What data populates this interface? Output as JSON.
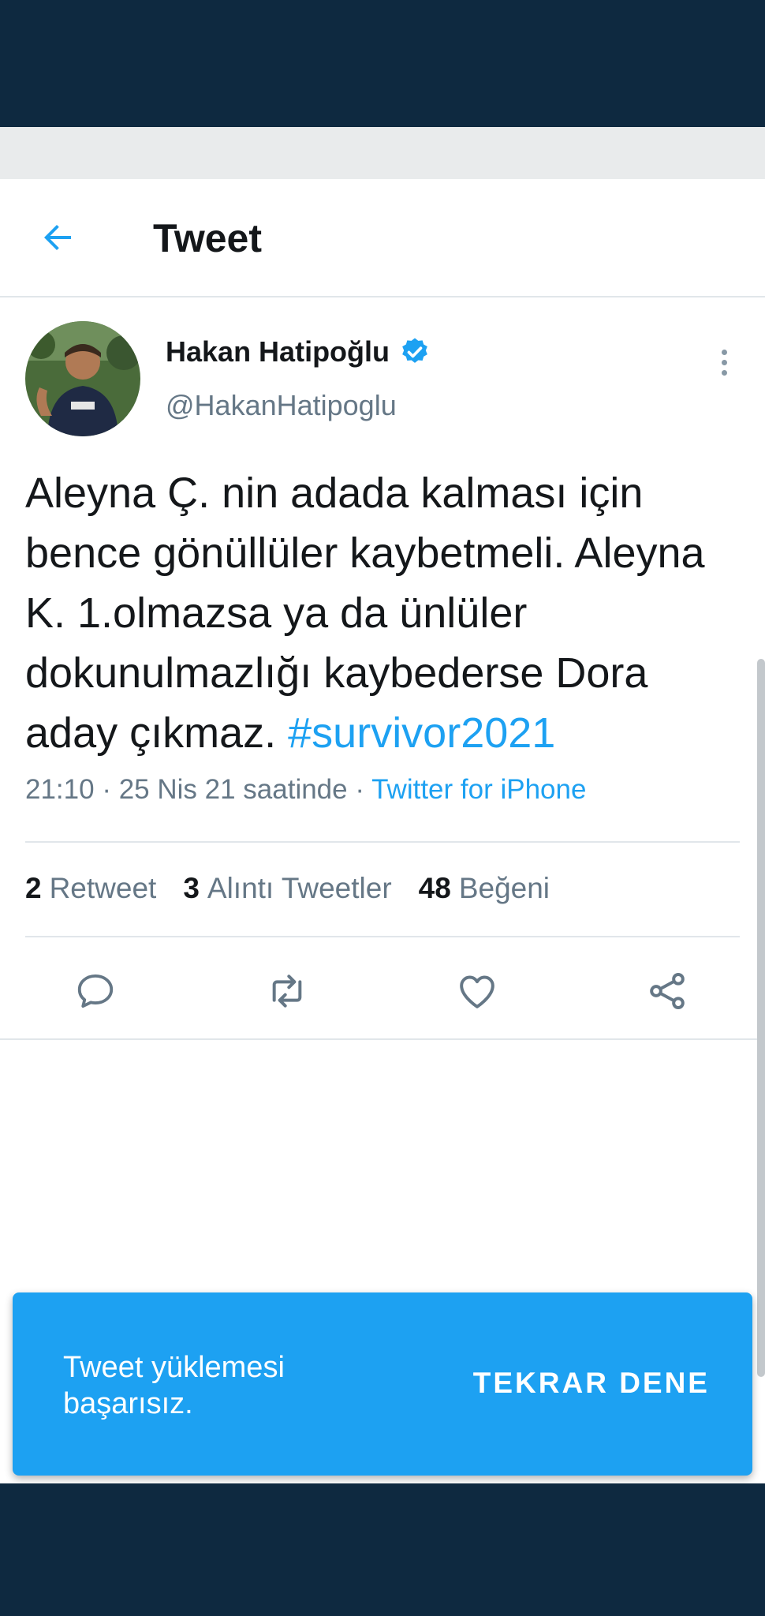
{
  "colors": {
    "accent": "#1da1f2",
    "status_bar": "#0e2940",
    "text": "#14171a",
    "secondary": "#657786"
  },
  "header": {
    "title": "Tweet",
    "back_icon": "arrow-left-icon"
  },
  "tweet": {
    "author": {
      "name": "Hakan Hatipoğlu",
      "handle": "@HakanHatipoglu",
      "verified": true
    },
    "text": "Aleyna Ç. nin adada kalması için bence gönüllüler kaybetmeli. Aleyna K. 1.olmazsa ya da ünlüler dokunulmazlığı kaybederse Dora aday çıkmaz.",
    "hashtag": "#survivor2021",
    "time": "21:10",
    "date": "25 Nis 21 saatinde",
    "source": "Twitter for iPhone",
    "stats": {
      "retweets": {
        "count": "2",
        "label": "Retweet"
      },
      "quotes": {
        "count": "3",
        "label": "Alıntı Tweetler"
      },
      "likes": {
        "count": "48",
        "label": "Beğeni"
      }
    },
    "actions": [
      "reply-icon",
      "retweet-icon",
      "like-icon",
      "share-icon"
    ]
  },
  "toast": {
    "message": "Tweet yüklemesi başarısız.",
    "action_label": "TEKRAR DENE"
  }
}
